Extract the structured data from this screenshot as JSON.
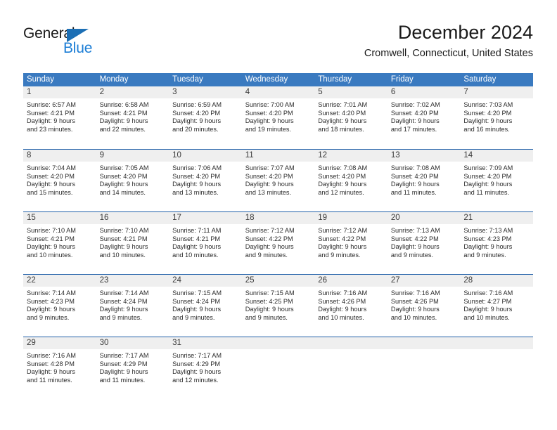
{
  "logo": {
    "word_top": "General",
    "word_bottom": "Blue",
    "triangle_color": "#1c6fb5",
    "blue_color": "#1c7ed6"
  },
  "header": {
    "title": "December 2024",
    "subtitle": "Cromwell, Connecticut, United States"
  },
  "theme": {
    "header_blue": "#3a7ac0",
    "separator_blue": "#1f5fa8",
    "day_strip_gray": "#efefef"
  },
  "weekdays": [
    "Sunday",
    "Monday",
    "Tuesday",
    "Wednesday",
    "Thursday",
    "Friday",
    "Saturday"
  ],
  "weeks": [
    [
      {
        "day": "1",
        "sunrise": "Sunrise: 6:57 AM",
        "sunset": "Sunset: 4:21 PM",
        "daylight1": "Daylight: 9 hours",
        "daylight2": "and 23 minutes."
      },
      {
        "day": "2",
        "sunrise": "Sunrise: 6:58 AM",
        "sunset": "Sunset: 4:21 PM",
        "daylight1": "Daylight: 9 hours",
        "daylight2": "and 22 minutes."
      },
      {
        "day": "3",
        "sunrise": "Sunrise: 6:59 AM",
        "sunset": "Sunset: 4:20 PM",
        "daylight1": "Daylight: 9 hours",
        "daylight2": "and 20 minutes."
      },
      {
        "day": "4",
        "sunrise": "Sunrise: 7:00 AM",
        "sunset": "Sunset: 4:20 PM",
        "daylight1": "Daylight: 9 hours",
        "daylight2": "and 19 minutes."
      },
      {
        "day": "5",
        "sunrise": "Sunrise: 7:01 AM",
        "sunset": "Sunset: 4:20 PM",
        "daylight1": "Daylight: 9 hours",
        "daylight2": "and 18 minutes."
      },
      {
        "day": "6",
        "sunrise": "Sunrise: 7:02 AM",
        "sunset": "Sunset: 4:20 PM",
        "daylight1": "Daylight: 9 hours",
        "daylight2": "and 17 minutes."
      },
      {
        "day": "7",
        "sunrise": "Sunrise: 7:03 AM",
        "sunset": "Sunset: 4:20 PM",
        "daylight1": "Daylight: 9 hours",
        "daylight2": "and 16 minutes."
      }
    ],
    [
      {
        "day": "8",
        "sunrise": "Sunrise: 7:04 AM",
        "sunset": "Sunset: 4:20 PM",
        "daylight1": "Daylight: 9 hours",
        "daylight2": "and 15 minutes."
      },
      {
        "day": "9",
        "sunrise": "Sunrise: 7:05 AM",
        "sunset": "Sunset: 4:20 PM",
        "daylight1": "Daylight: 9 hours",
        "daylight2": "and 14 minutes."
      },
      {
        "day": "10",
        "sunrise": "Sunrise: 7:06 AM",
        "sunset": "Sunset: 4:20 PM",
        "daylight1": "Daylight: 9 hours",
        "daylight2": "and 13 minutes."
      },
      {
        "day": "11",
        "sunrise": "Sunrise: 7:07 AM",
        "sunset": "Sunset: 4:20 PM",
        "daylight1": "Daylight: 9 hours",
        "daylight2": "and 13 minutes."
      },
      {
        "day": "12",
        "sunrise": "Sunrise: 7:08 AM",
        "sunset": "Sunset: 4:20 PM",
        "daylight1": "Daylight: 9 hours",
        "daylight2": "and 12 minutes."
      },
      {
        "day": "13",
        "sunrise": "Sunrise: 7:08 AM",
        "sunset": "Sunset: 4:20 PM",
        "daylight1": "Daylight: 9 hours",
        "daylight2": "and 11 minutes."
      },
      {
        "day": "14",
        "sunrise": "Sunrise: 7:09 AM",
        "sunset": "Sunset: 4:20 PM",
        "daylight1": "Daylight: 9 hours",
        "daylight2": "and 11 minutes."
      }
    ],
    [
      {
        "day": "15",
        "sunrise": "Sunrise: 7:10 AM",
        "sunset": "Sunset: 4:21 PM",
        "daylight1": "Daylight: 9 hours",
        "daylight2": "and 10 minutes."
      },
      {
        "day": "16",
        "sunrise": "Sunrise: 7:10 AM",
        "sunset": "Sunset: 4:21 PM",
        "daylight1": "Daylight: 9 hours",
        "daylight2": "and 10 minutes."
      },
      {
        "day": "17",
        "sunrise": "Sunrise: 7:11 AM",
        "sunset": "Sunset: 4:21 PM",
        "daylight1": "Daylight: 9 hours",
        "daylight2": "and 10 minutes."
      },
      {
        "day": "18",
        "sunrise": "Sunrise: 7:12 AM",
        "sunset": "Sunset: 4:22 PM",
        "daylight1": "Daylight: 9 hours",
        "daylight2": "and 9 minutes."
      },
      {
        "day": "19",
        "sunrise": "Sunrise: 7:12 AM",
        "sunset": "Sunset: 4:22 PM",
        "daylight1": "Daylight: 9 hours",
        "daylight2": "and 9 minutes."
      },
      {
        "day": "20",
        "sunrise": "Sunrise: 7:13 AM",
        "sunset": "Sunset: 4:22 PM",
        "daylight1": "Daylight: 9 hours",
        "daylight2": "and 9 minutes."
      },
      {
        "day": "21",
        "sunrise": "Sunrise: 7:13 AM",
        "sunset": "Sunset: 4:23 PM",
        "daylight1": "Daylight: 9 hours",
        "daylight2": "and 9 minutes."
      }
    ],
    [
      {
        "day": "22",
        "sunrise": "Sunrise: 7:14 AM",
        "sunset": "Sunset: 4:23 PM",
        "daylight1": "Daylight: 9 hours",
        "daylight2": "and 9 minutes."
      },
      {
        "day": "23",
        "sunrise": "Sunrise: 7:14 AM",
        "sunset": "Sunset: 4:24 PM",
        "daylight1": "Daylight: 9 hours",
        "daylight2": "and 9 minutes."
      },
      {
        "day": "24",
        "sunrise": "Sunrise: 7:15 AM",
        "sunset": "Sunset: 4:24 PM",
        "daylight1": "Daylight: 9 hours",
        "daylight2": "and 9 minutes."
      },
      {
        "day": "25",
        "sunrise": "Sunrise: 7:15 AM",
        "sunset": "Sunset: 4:25 PM",
        "daylight1": "Daylight: 9 hours",
        "daylight2": "and 9 minutes."
      },
      {
        "day": "26",
        "sunrise": "Sunrise: 7:16 AM",
        "sunset": "Sunset: 4:26 PM",
        "daylight1": "Daylight: 9 hours",
        "daylight2": "and 10 minutes."
      },
      {
        "day": "27",
        "sunrise": "Sunrise: 7:16 AM",
        "sunset": "Sunset: 4:26 PM",
        "daylight1": "Daylight: 9 hours",
        "daylight2": "and 10 minutes."
      },
      {
        "day": "28",
        "sunrise": "Sunrise: 7:16 AM",
        "sunset": "Sunset: 4:27 PM",
        "daylight1": "Daylight: 9 hours",
        "daylight2": "and 10 minutes."
      }
    ],
    [
      {
        "day": "29",
        "sunrise": "Sunrise: 7:16 AM",
        "sunset": "Sunset: 4:28 PM",
        "daylight1": "Daylight: 9 hours",
        "daylight2": "and 11 minutes."
      },
      {
        "day": "30",
        "sunrise": "Sunrise: 7:17 AM",
        "sunset": "Sunset: 4:29 PM",
        "daylight1": "Daylight: 9 hours",
        "daylight2": "and 11 minutes."
      },
      {
        "day": "31",
        "sunrise": "Sunrise: 7:17 AM",
        "sunset": "Sunset: 4:29 PM",
        "daylight1": "Daylight: 9 hours",
        "daylight2": "and 12 minutes."
      },
      {
        "day": "",
        "sunrise": "",
        "sunset": "",
        "daylight1": "",
        "daylight2": ""
      },
      {
        "day": "",
        "sunrise": "",
        "sunset": "",
        "daylight1": "",
        "daylight2": ""
      },
      {
        "day": "",
        "sunrise": "",
        "sunset": "",
        "daylight1": "",
        "daylight2": ""
      },
      {
        "day": "",
        "sunrise": "",
        "sunset": "",
        "daylight1": "",
        "daylight2": ""
      }
    ]
  ]
}
